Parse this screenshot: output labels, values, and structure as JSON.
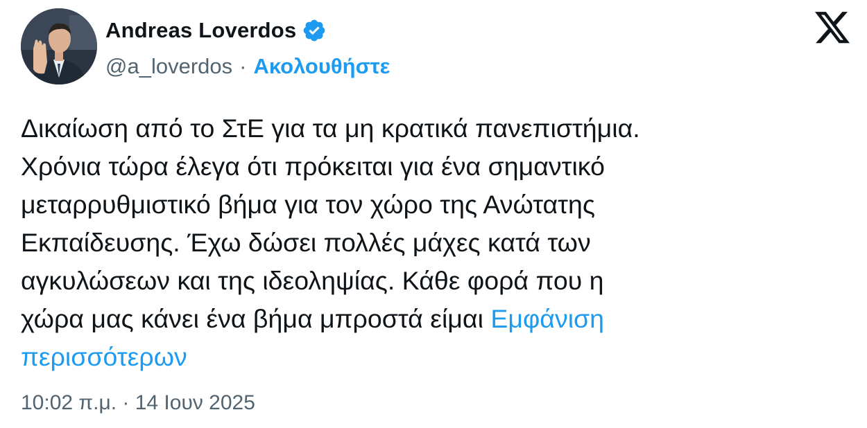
{
  "author": {
    "display_name": "Andreas Loverdos",
    "handle": "@a_loverdos",
    "separator": "·",
    "follow_label": "Ακολουθήστε",
    "verified": true
  },
  "tweet": {
    "lines": [
      "Δικαίωση από το ΣτΕ για τα μη κρατικά πανεπιστήμια.",
      "Χρόνια τώρα έλεγα ότι πρόκειται για ένα σημαντικό",
      "μεταρρυθμιστικό βήμα για τον χώρο της Ανώτατης",
      "Εκπαίδευσης. Έχω δώσει πολλές μάχες κατά των",
      "αγκυλώσεων και της ιδεοληψίας. Κάθε φορά που η",
      "χώρα μας κάνει ένα βήμα μπροστά είμαι "
    ],
    "show_more_part1": "Εμφάνιση",
    "show_more_part2": "περισσότερων",
    "timestamp": "10:02 π.μ. · 14 Ιουν 2025"
  },
  "icons": {
    "verified": "verified-badge-icon",
    "platform": "x-logo-icon"
  },
  "colors": {
    "text": "#0f1419",
    "secondary": "#536471",
    "accent": "#1d9bf0"
  }
}
